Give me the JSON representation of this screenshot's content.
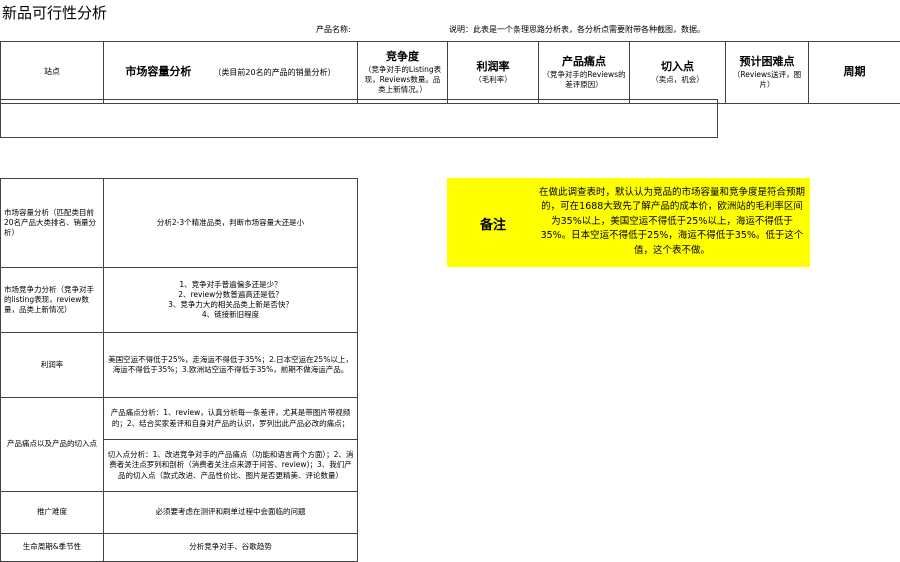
{
  "title": "新品可行性分析",
  "product_name_label": "产品名称:",
  "description": "说明：此表是一个条理思路分析表，各分析点需要附带各种截图，数据。",
  "header": {
    "site": "站点",
    "market": {
      "main": "市场容量分析",
      "sub": "（类目前20名的产品的销量分析）"
    },
    "competition": {
      "main": "竞争度",
      "sub": "（竞争对手的Listing表现，Reviews数量。品类上新情况。）"
    },
    "margin": {
      "main": "利润率",
      "sub": "（毛利率）"
    },
    "pain": {
      "main": "产品痛点",
      "sub": "（竞争对手的Reviews的差评原因）"
    },
    "entry": {
      "main": "切入点",
      "sub": "（卖点，机会）"
    },
    "difficulty": {
      "main": "预计困难点",
      "sub": "（Reviews送评，图片）"
    },
    "cycle": {
      "main": "周期"
    }
  },
  "rows": [
    {
      "label": "市场容量分析（匹配类目前20名产品大类排名、销量分析）",
      "content": "分析2-3个精准品类，判断市场容量大还是小"
    },
    {
      "label": "市场竞争力分析（竞争对手的listing表现，review数量，品类上新情况）",
      "content_lines": [
        "1、竞争对手普遍偏多还是少？",
        "2、review分数普遍高还是低？",
        "3、竞争力大的相关品类上新是否快？",
        "4、链接新旧程度"
      ]
    },
    {
      "label": "利润率",
      "content": "美国空运不得低于25%，走海运不得低于35%；2.日本空运在25%以上，海运不得低于35%；3.欧洲站空运不得低于35%，前期不做海运产品。"
    },
    {
      "label": "产品痛点以及产品的切入点",
      "content_a": "产品痛点分析：1、review，认真分析每一条差评，尤其是带图片带视频的；2、结合买家差评和自身对产品的认识，罗列出此产品必改的痛点；",
      "content_b": "切入点分析：1、改进竞争对手的产品痛点（功能和语言两个方面）；2、消费者关注点罗列和剖析（消费者关注点来源于问答、review)；3、我们产品的切入点（款式改进、产品性价比、图片是否更精美、评论数量）"
    },
    {
      "label": "推广难度",
      "content": "必须要考虑在测评和刷单过程中会面临的问题"
    },
    {
      "label": "生命周期&季节性",
      "content": "分析竞争对手、谷歌趋势"
    }
  ],
  "note": {
    "label": "备注",
    "text": "在做此调查表时，默认认为竞品的市场容量和竞争度是符合预期的，可在1688大致先了解产品的成本价，欧洲站的毛利率区间为35%以上，美国空运不得低于25%以上，海运不得低于35%。日本空运不得低于25%，海运不得低于35%。低于这个值，这个表不做。"
  },
  "colors": {
    "note_bg": "#ffff00",
    "border": "#444444"
  }
}
